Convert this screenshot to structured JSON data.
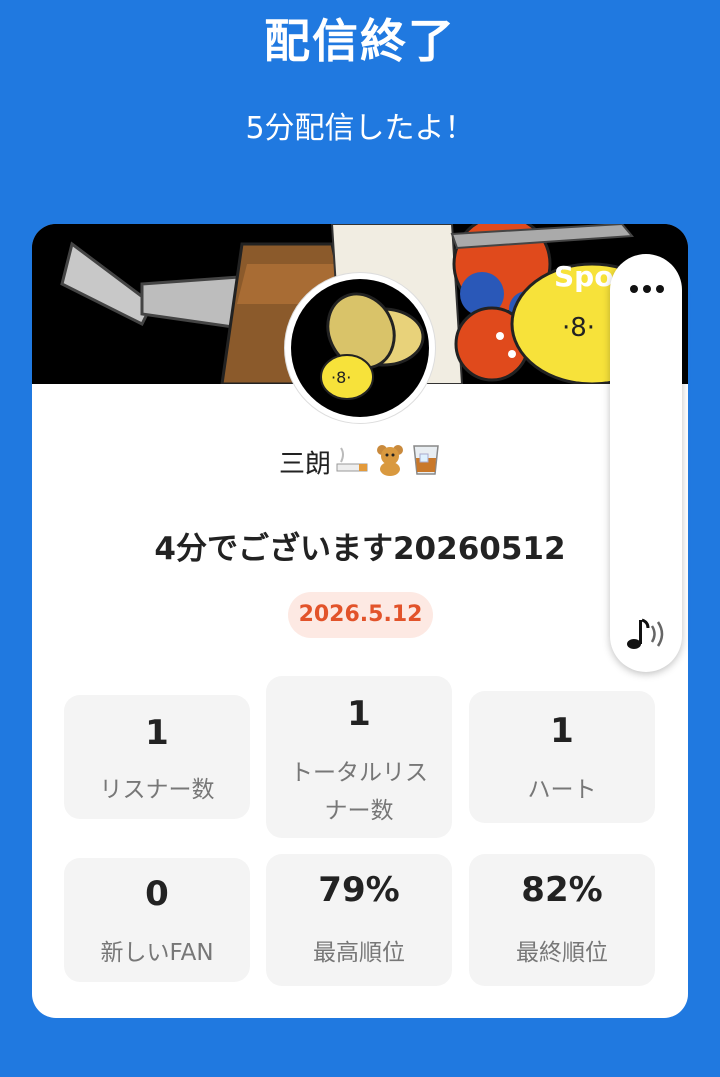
{
  "header": {
    "title": "配信終了",
    "subtitle": "5分配信したよ！"
  },
  "banner": {
    "text": "Spo"
  },
  "profile": {
    "username": "三朗",
    "emoji_icons": [
      "cigarette-icon",
      "teddy-bear-icon",
      "whiskey-glass-icon"
    ]
  },
  "broadcast": {
    "title": "4分でございます20260512",
    "date": "2026.5.12"
  },
  "stats": [
    {
      "value": "1",
      "label": "リスナー数"
    },
    {
      "value": "1",
      "label": "トータルリスナー数"
    },
    {
      "value": "1",
      "label": "ハート"
    },
    {
      "value": "0",
      "label": "新しいFAN"
    },
    {
      "value": "79%",
      "label": "最高順位"
    },
    {
      "value": "82%",
      "label": "最終順位"
    }
  ],
  "floating_panel": {
    "icons": [
      "more-options-icon",
      "sound-wave-icon"
    ]
  },
  "colors": {
    "background": "#2079e0",
    "date_badge_bg": "#fde9e3",
    "date_badge_text": "#e2532a",
    "stat_bg": "#f4f4f4"
  }
}
